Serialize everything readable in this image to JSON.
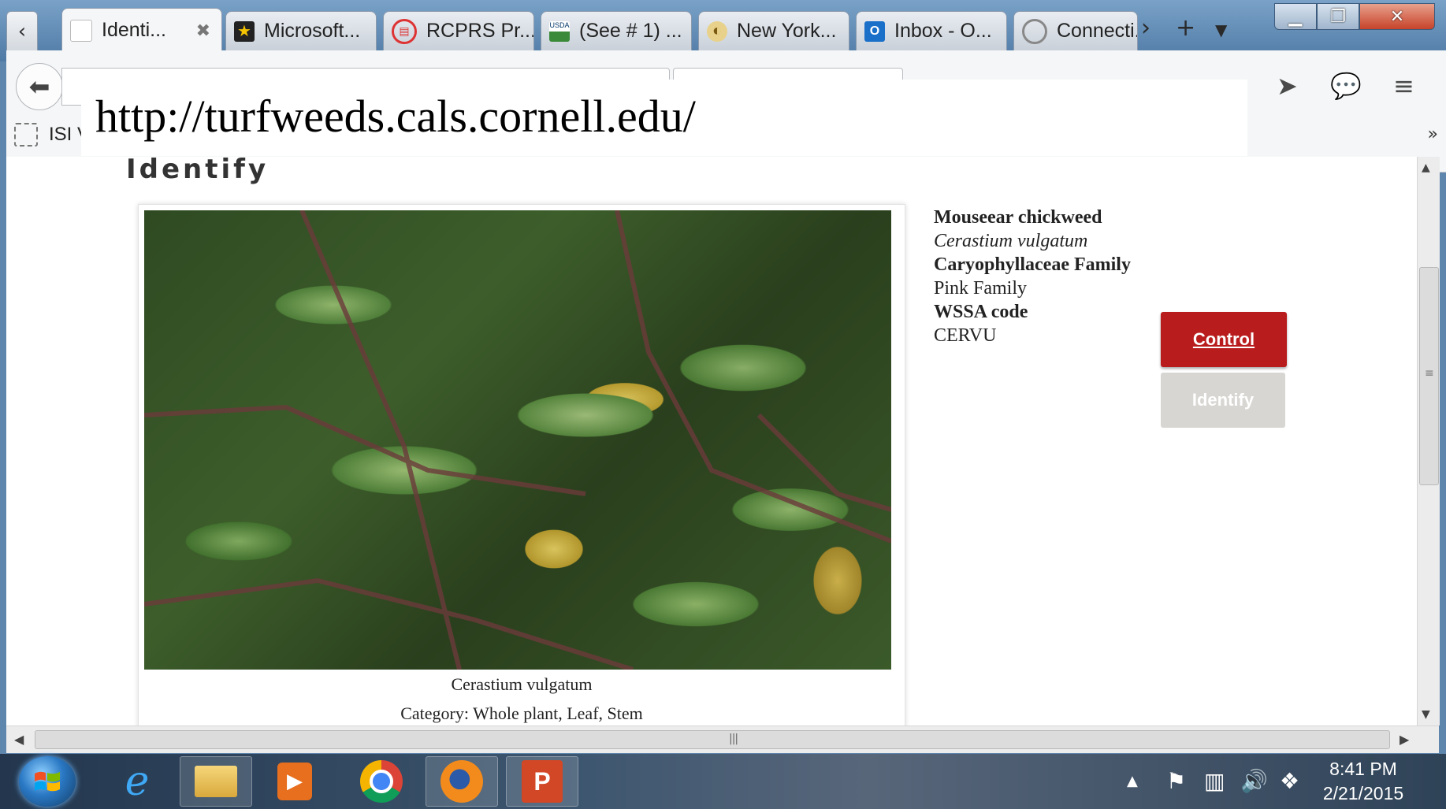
{
  "browser": {
    "tabs": [
      {
        "label": "Identi...",
        "icon": "page-icon",
        "active": true
      },
      {
        "label": "Microsoft...",
        "icon": "star-icon"
      },
      {
        "label": "RCPRS Pr...",
        "icon": "shield-icon"
      },
      {
        "label": "(See # 1) ...",
        "icon": "usda-icon"
      },
      {
        "label": "New York...",
        "icon": "seed-icon"
      },
      {
        "label": "Inbox - O...",
        "icon": "outlook-icon"
      },
      {
        "label": "Connecti...",
        "icon": "loading-icon"
      }
    ],
    "bookmarks": [
      {
        "label": "ISI V"
      }
    ]
  },
  "url_overlay": "http://turfweeds.cals.cornell.edu/",
  "page": {
    "heading": "Identify",
    "photo_caption": "Cerastium vulgatum",
    "category_text": "Category: Whole plant, Leaf, Stem",
    "info": {
      "common_name": "Mouseear chickweed",
      "scientific_name": "Cerastium vulgatum",
      "family": "Caryophyllaceae Family",
      "family_common": "Pink Family",
      "wssa_label": "WSSA code",
      "wssa_code": "CERVU"
    },
    "buttons": {
      "control": "Control",
      "identify": "Identify"
    }
  },
  "taskbar": {
    "time": "8:41 PM",
    "date": "2/21/2015"
  },
  "colors": {
    "control_button": "#b91c1c",
    "identify_button": "#d8d6d2"
  }
}
